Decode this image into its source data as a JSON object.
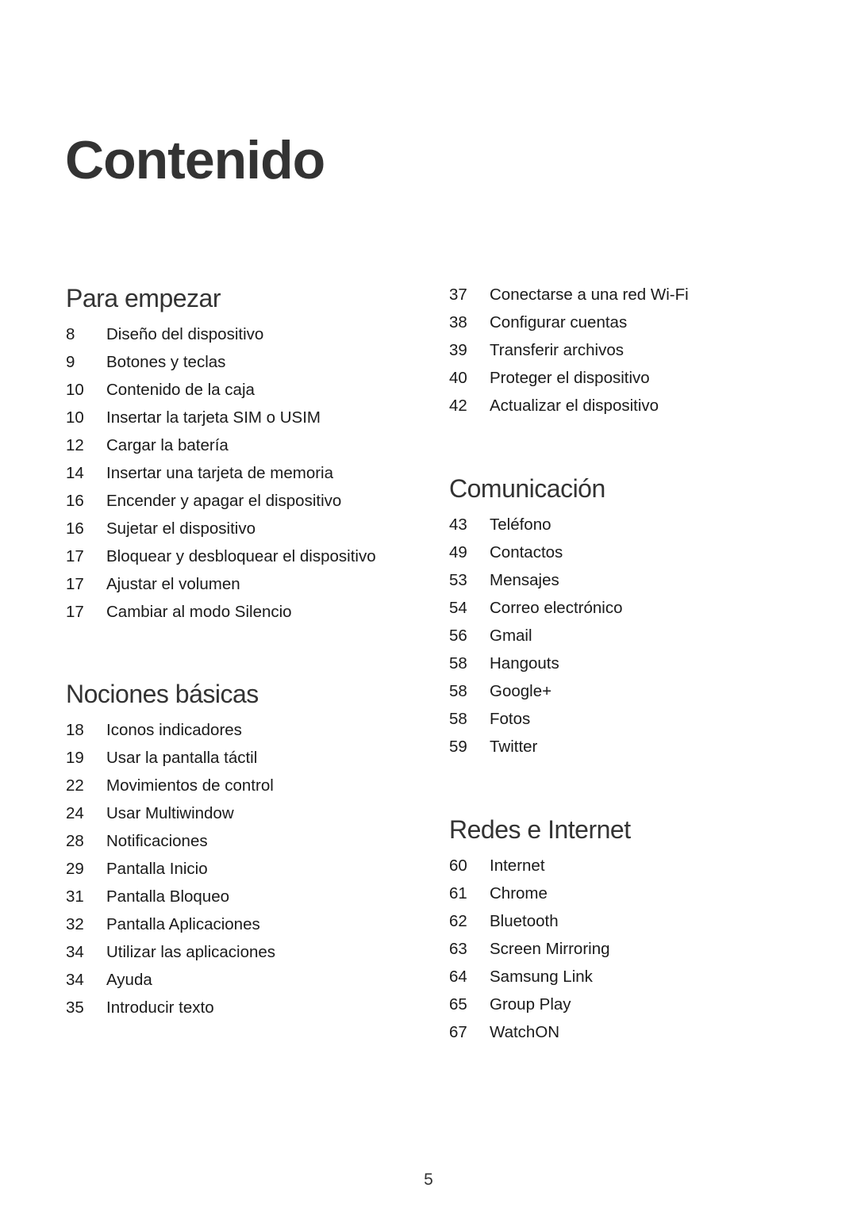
{
  "title": "Contenido",
  "page_number": "5",
  "sections": [
    {
      "title": "Para empezar",
      "items": [
        {
          "page": "8",
          "label": "Diseño del dispositivo"
        },
        {
          "page": "9",
          "label": "Botones y teclas"
        },
        {
          "page": "10",
          "label": "Contenido de la caja"
        },
        {
          "page": "10",
          "label": "Insertar la tarjeta SIM o USIM"
        },
        {
          "page": "12",
          "label": "Cargar la batería"
        },
        {
          "page": "14",
          "label": "Insertar una tarjeta de memoria"
        },
        {
          "page": "16",
          "label": "Encender y apagar el dispositivo"
        },
        {
          "page": "16",
          "label": "Sujetar el dispositivo"
        },
        {
          "page": "17",
          "label": "Bloquear y desbloquear el dispositivo"
        },
        {
          "page": "17",
          "label": "Ajustar el volumen"
        },
        {
          "page": "17",
          "label": "Cambiar al modo Silencio"
        }
      ]
    },
    {
      "title": "Nociones básicas",
      "items": [
        {
          "page": "18",
          "label": "Iconos indicadores"
        },
        {
          "page": "19",
          "label": "Usar la pantalla táctil"
        },
        {
          "page": "22",
          "label": "Movimientos de control"
        },
        {
          "page": "24",
          "label": "Usar Multiwindow"
        },
        {
          "page": "28",
          "label": "Notificaciones"
        },
        {
          "page": "29",
          "label": "Pantalla Inicio"
        },
        {
          "page": "31",
          "label": "Pantalla Bloqueo"
        },
        {
          "page": "32",
          "label": "Pantalla Aplicaciones"
        },
        {
          "page": "34",
          "label": "Utilizar las aplicaciones"
        },
        {
          "page": "34",
          "label": "Ayuda"
        },
        {
          "page": "35",
          "label": "Introducir texto"
        }
      ]
    },
    {
      "title": "",
      "items": [
        {
          "page": "37",
          "label": "Conectarse a una red Wi-Fi"
        },
        {
          "page": "38",
          "label": "Configurar cuentas"
        },
        {
          "page": "39",
          "label": "Transferir archivos"
        },
        {
          "page": "40",
          "label": "Proteger el dispositivo"
        },
        {
          "page": "42",
          "label": "Actualizar el dispositivo"
        }
      ]
    },
    {
      "title": "Comunicación",
      "items": [
        {
          "page": "43",
          "label": "Teléfono"
        },
        {
          "page": "49",
          "label": "Contactos"
        },
        {
          "page": "53",
          "label": "Mensajes"
        },
        {
          "page": "54",
          "label": "Correo electrónico"
        },
        {
          "page": "56",
          "label": "Gmail"
        },
        {
          "page": "58",
          "label": "Hangouts"
        },
        {
          "page": "58",
          "label": "Google+"
        },
        {
          "page": "58",
          "label": "Fotos"
        },
        {
          "page": "59",
          "label": "Twitter"
        }
      ]
    },
    {
      "title": "Redes e Internet",
      "items": [
        {
          "page": "60",
          "label": "Internet"
        },
        {
          "page": "61",
          "label": "Chrome"
        },
        {
          "page": "62",
          "label": "Bluetooth"
        },
        {
          "page": "63",
          "label": "Screen Mirroring"
        },
        {
          "page": "64",
          "label": "Samsung Link"
        },
        {
          "page": "65",
          "label": "Group Play"
        },
        {
          "page": "67",
          "label": "WatchON"
        }
      ]
    }
  ]
}
